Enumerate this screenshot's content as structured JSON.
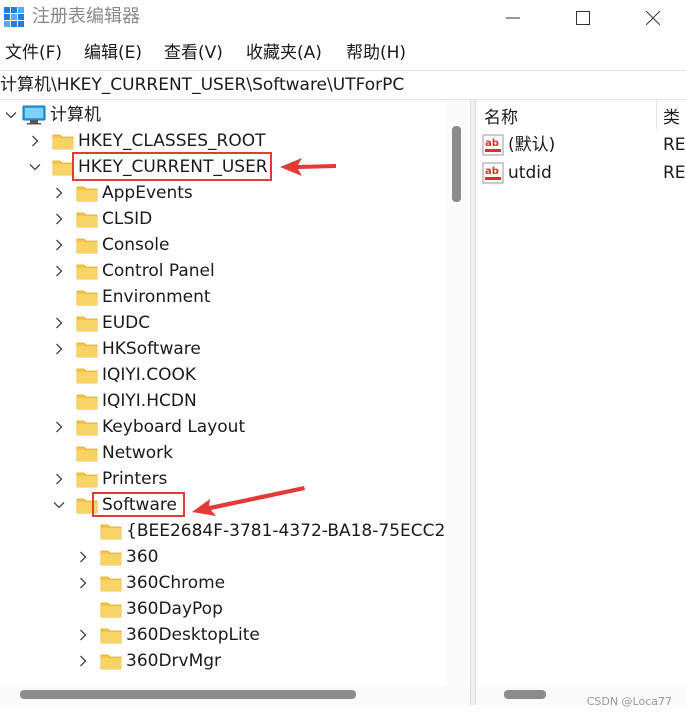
{
  "window": {
    "title": "注册表编辑器"
  },
  "menu": [
    {
      "label": "文件(F)"
    },
    {
      "label": "编辑(E)"
    },
    {
      "label": "查看(V)"
    },
    {
      "label": "收藏夹(A)"
    },
    {
      "label": "帮助(H)"
    }
  ],
  "address": {
    "path": "计算机\\HKEY_CURRENT_USER\\Software\\UTForPC"
  },
  "tree": {
    "root": "计算机",
    "items": [
      {
        "label": "HKEY_CLASSES_ROOT",
        "expander": "collapsed"
      },
      {
        "label": "HKEY_CURRENT_USER",
        "expander": "expanded"
      },
      {
        "label": "AppEvents",
        "expander": "collapsed"
      },
      {
        "label": "CLSID",
        "expander": "collapsed"
      },
      {
        "label": "Console",
        "expander": "collapsed"
      },
      {
        "label": "Control Panel",
        "expander": "collapsed"
      },
      {
        "label": "Environment",
        "expander": "none"
      },
      {
        "label": "EUDC",
        "expander": "collapsed"
      },
      {
        "label": "HKSoftware",
        "expander": "collapsed"
      },
      {
        "label": "IQIYI.COOK",
        "expander": "none"
      },
      {
        "label": "IQIYI.HCDN",
        "expander": "none"
      },
      {
        "label": "Keyboard Layout",
        "expander": "collapsed"
      },
      {
        "label": "Network",
        "expander": "none"
      },
      {
        "label": "Printers",
        "expander": "collapsed"
      },
      {
        "label": "Software",
        "expander": "expanded"
      },
      {
        "label": "{BEE2684F-3781-4372-BA18-75ECC2",
        "expander": "none"
      },
      {
        "label": "360",
        "expander": "collapsed"
      },
      {
        "label": "360Chrome",
        "expander": "collapsed"
      },
      {
        "label": "360DayPop",
        "expander": "none"
      },
      {
        "label": "360DesktopLite",
        "expander": "collapsed"
      },
      {
        "label": "360DrvMgr",
        "expander": "collapsed"
      }
    ]
  },
  "values": {
    "columns": {
      "name": "名称",
      "type": "类"
    },
    "rows": [
      {
        "name": "(默认)",
        "type": "RE"
      },
      {
        "name": "utdid",
        "type": "RE"
      }
    ]
  },
  "watermark": "CSDN @Loca77",
  "colors": {
    "annotation_red": "#e53935",
    "folder_yellow": "#f5c645",
    "app_icon_blue": "#1f7fd6"
  }
}
